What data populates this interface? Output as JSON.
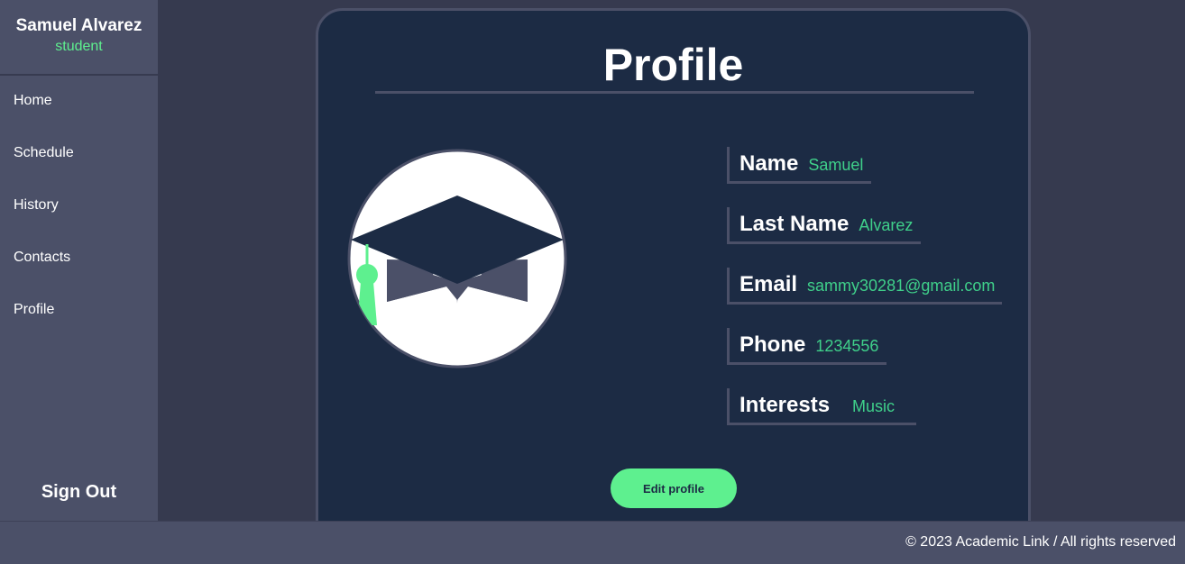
{
  "sidebar": {
    "user_name": "Samuel Alvarez",
    "user_role": "student",
    "items": [
      {
        "label": "Home"
      },
      {
        "label": "Schedule"
      },
      {
        "label": "History"
      },
      {
        "label": "Contacts"
      },
      {
        "label": "Profile"
      }
    ],
    "signout_label": "Sign Out"
  },
  "profile": {
    "title": "Profile",
    "avatar_icon": "graduation-cap-icon",
    "fields": [
      {
        "label": "Name",
        "value": "Samuel"
      },
      {
        "label": "Last Name",
        "value": "Alvarez"
      },
      {
        "label": "Email",
        "value": "sammy30281@gmail.com"
      },
      {
        "label": "Phone",
        "value": "1234556"
      },
      {
        "label": "Interests",
        "value": "Music"
      }
    ],
    "edit_label": "Edit profile"
  },
  "footer": {
    "text": "© 2023 Academic Link / All rights reserved"
  },
  "colors": {
    "background": "#363a4f",
    "sidebar": "#4b5068",
    "card": "#1c2b44",
    "accent": "#5ef08f",
    "value_text": "#3fd08a"
  }
}
